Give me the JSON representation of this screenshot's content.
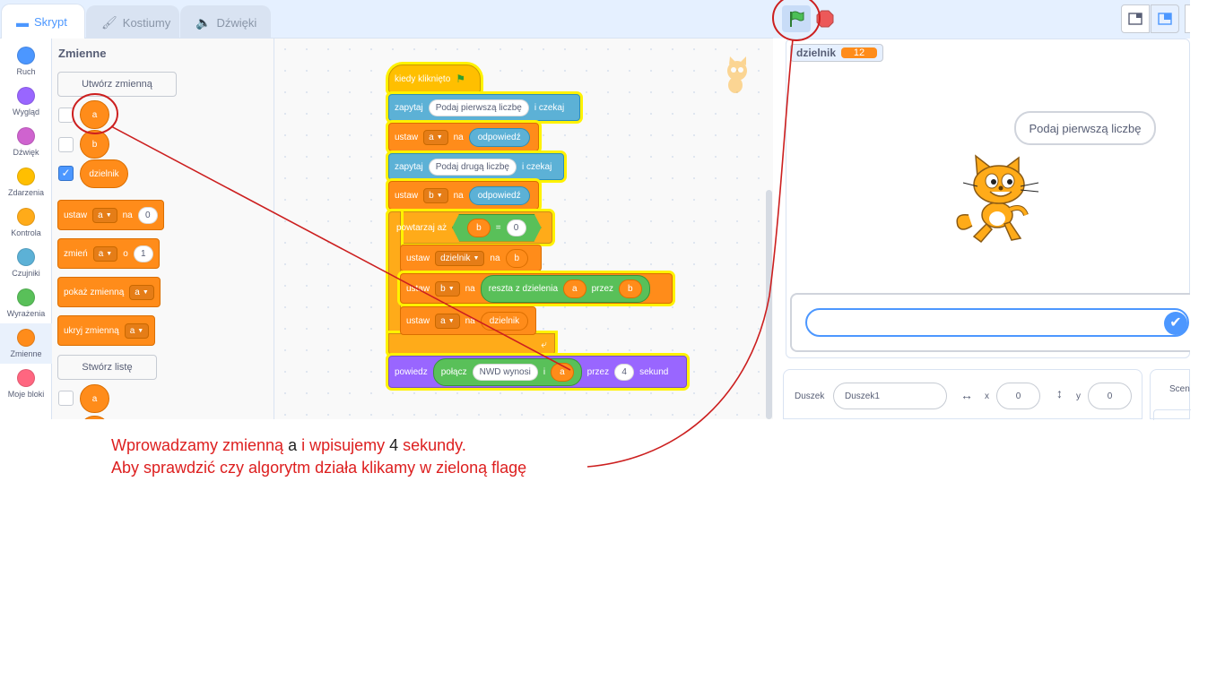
{
  "tabs": {
    "code": "Skrypt",
    "costumes": "Kostiumy",
    "sounds": "Dźwięki"
  },
  "categories": [
    {
      "label": "Ruch",
      "color": "#4c97ff"
    },
    {
      "label": "Wygląd",
      "color": "#9966ff"
    },
    {
      "label": "Dźwięk",
      "color": "#cf63cf"
    },
    {
      "label": "Zdarzenia",
      "color": "#ffbf00"
    },
    {
      "label": "Kontrola",
      "color": "#ffab19"
    },
    {
      "label": "Czujniki",
      "color": "#5cb1d6"
    },
    {
      "label": "Wyrażenia",
      "color": "#59c059"
    },
    {
      "label": "Zmienne",
      "color": "#ff8c1a"
    },
    {
      "label": "Moje bloki",
      "color": "#ff6680"
    }
  ],
  "palette": {
    "title": "Zmienne",
    "make_variable": "Utwórz zmienną",
    "variables": [
      {
        "name": "a",
        "checked": false
      },
      {
        "name": "b",
        "checked": false
      },
      {
        "name": "dzielnik",
        "checked": true
      }
    ],
    "set_block": {
      "label": "ustaw",
      "var": "a",
      "to": "na",
      "value": "0"
    },
    "change_block": {
      "label": "zmień",
      "var": "a",
      "by": "o",
      "value": "1"
    },
    "show_block": {
      "label": "pokaż zmienną",
      "var": "a"
    },
    "hide_block": {
      "label": "ukryj zmienną",
      "var": "a"
    },
    "make_list": "Stwórz listę",
    "list_name": "a"
  },
  "script": {
    "hat": "kiedy kliknięto",
    "ask1": {
      "label": "zapytaj",
      "text": "Podaj pierwszą liczbę",
      "suffix": "i czekaj"
    },
    "set_a": {
      "label": "ustaw",
      "var": "a",
      "to": "na",
      "value": "odpowiedź"
    },
    "ask2": {
      "label": "zapytaj",
      "text": "Podaj drugą liczbę",
      "suffix": "i czekaj"
    },
    "set_b": {
      "label": "ustaw",
      "var": "b",
      "to": "na",
      "value": "odpowiedź"
    },
    "repeat": {
      "label": "powtarzaj aż",
      "left": "b",
      "op": "=",
      "right": "0"
    },
    "set_div": {
      "label": "ustaw",
      "var": "dzielnik",
      "to": "na",
      "value": "b"
    },
    "set_b2": {
      "label": "ustaw",
      "var": "b",
      "to": "na",
      "op": "reszta z dzielenia",
      "a": "a",
      "by": "przez",
      "b": "b"
    },
    "set_a2": {
      "label": "ustaw",
      "var": "a",
      "to": "na",
      "value": "dzielnik"
    },
    "say": {
      "label": "powiedz",
      "join": "połącz",
      "text": "NWD wynosi",
      "and": "i",
      "var": "a",
      "for": "przez",
      "secs": "4",
      "unit": "sekund"
    }
  },
  "stage": {
    "monitor_name": "dzielnik",
    "monitor_value": "12",
    "speech": "Podaj pierwszą liczbę"
  },
  "sprite_info": {
    "sprite_label": "Duszek",
    "sprite_name": "Duszek1",
    "x_label": "x",
    "x_value": "0",
    "y_label": "y",
    "y_value": "0",
    "scene_label": "Scen"
  },
  "annotation": {
    "line1_a": "Wprowadzamy zmienną ",
    "line1_var": "a",
    "line1_b": " i wpisujemy ",
    "line1_num": "4",
    "line1_c": " sekundy.",
    "line2": "Aby sprawdzić czy algorytm działa klikamy w zieloną flagę",
    "color": "#dd1f1f"
  }
}
